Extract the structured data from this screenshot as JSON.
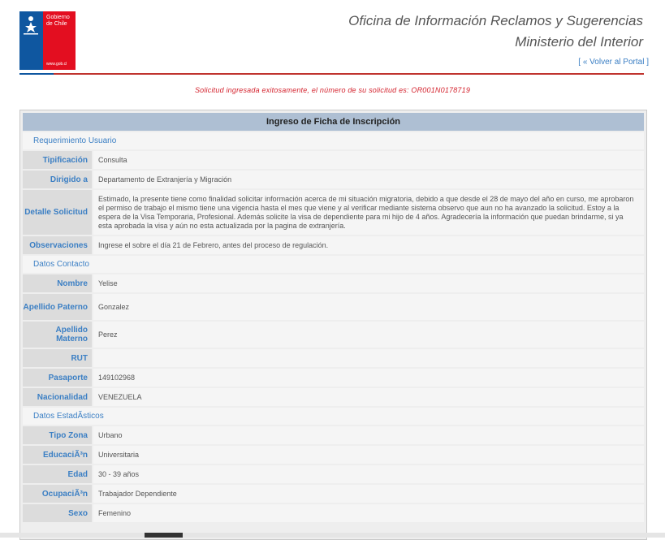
{
  "logo": {
    "line1": "Gobierno",
    "line2": "de Chile",
    "url": "www.gob.cl",
    "colors": {
      "blue": "#0f57a0",
      "red": "#e30e20"
    }
  },
  "header": {
    "title1": "Oficina de Información Reclamos y Sugerencias",
    "title2": "Ministerio del Interior",
    "back_open": "[ ",
    "back_label": "« Volver al Portal",
    "back_close": " ]"
  },
  "message": "Solicitud ingresada exitosamente, el número de su solicitud es: OR001N0178719",
  "form": {
    "title": "Ingreso de Ficha de Inscripción",
    "section_requerimiento": "Requerimiento Usuario",
    "tipificacion_label": "Tipificación",
    "tipificacion_value": "Consulta",
    "dirigido_label": "Dirigido a",
    "dirigido_value": "Departamento de Extranjería y Migración",
    "detalle_label": "Detalle Solicitud",
    "detalle_value": "Estimado, la presente tiene como finalidad solicitar información acerca de mi situación migratoria, debido a que desde el 28 de mayo del año en curso, me aprobaron el permiso de trabajo el mismo tiene una vigencia hasta el mes que viene y al verificar mediante sistema observo que aun no ha avanzado la solicitud. Estoy a la espera de la Visa Temporaria, Profesional. Además solicite la visa de dependiente para mi hijo de 4 años. Agradecería la información que puedan brindarme, si ya esta aprobada la visa y aún no esta actualizada por la pagina de extranjería.",
    "observaciones_label": "Observaciones",
    "observaciones_value": "Ingrese el sobre el día 21 de Febrero, antes del proceso de regulación.",
    "section_contacto": "Datos Contacto",
    "nombre_label": "Nombre",
    "nombre_value": "Yelise",
    "paterno_label": "Apellido Paterno",
    "paterno_value": "Gonzalez",
    "materno_label": "Apellido Materno",
    "materno_value": "Perez",
    "rut_label": "RUT",
    "rut_value": "",
    "pasaporte_label": "Pasaporte",
    "pasaporte_value": "149102968",
    "nacionalidad_label": "Nacionalidad",
    "nacionalidad_value": "VENEZUELA",
    "section_estadisticos": "Datos EstadÃ­sticos",
    "zona_label": "Tipo Zona",
    "zona_value": "Urbano",
    "educacion_label": "EducaciÃ³n",
    "educacion_value": "Universitaria",
    "edad_label": "Edad",
    "edad_value": "30 - 39 años",
    "ocupacion_label": "OcupaciÃ³n",
    "ocupacion_value": "Trabajador Dependiente",
    "sexo_label": "Sexo",
    "sexo_value": "Femenino"
  }
}
